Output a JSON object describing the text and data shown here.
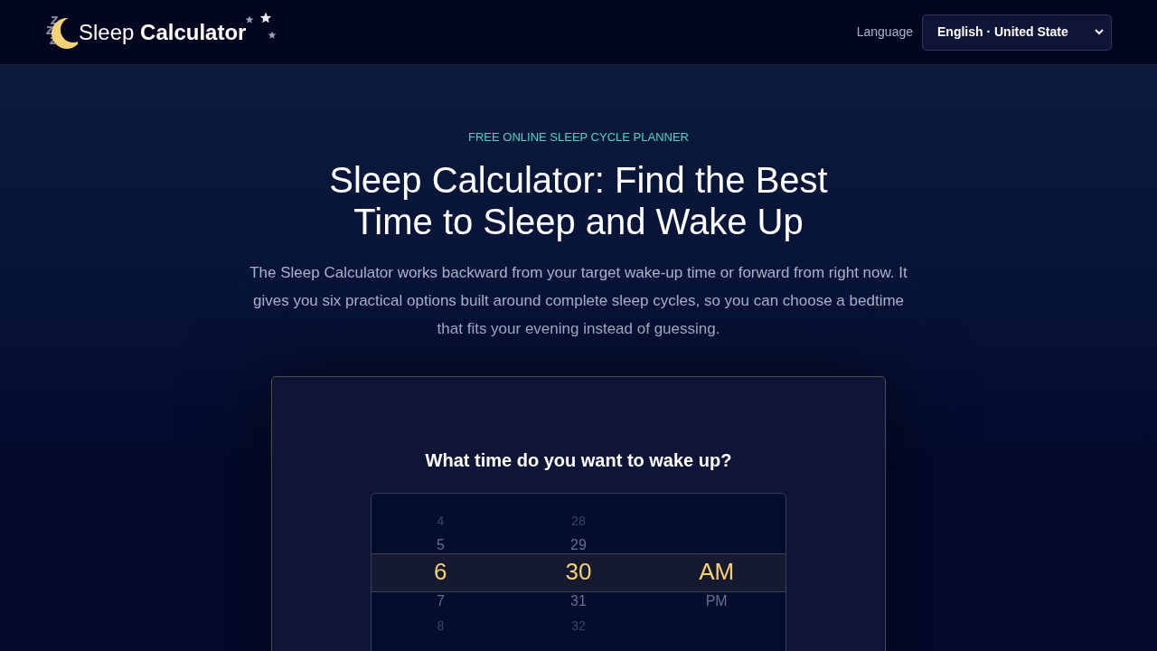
{
  "header": {
    "logo": "Sleep **Calculator**",
    "language_label": "Language",
    "language_select": {
      "value": "English · United State"
    }
  },
  "hero": {
    "eyebrow": "FREE ONLINE SLEEP CYCLE PLANNER",
    "title": "Sleep Calculator: Find the Best Time to Sleep and Wake Up",
    "intro": "The Sleep Calculator works backward from your target wake-up time or forward from right now. It gives you six practical options built around complete sleep cycles, so you can choose a bedtime that fits your evening instead of guessing."
  },
  "calculator": {
    "question": "What time do you want to wake up?",
    "time_picker": {
      "columns": [
        {
          "items": [
            {
              "label": "4",
              "selected": false
            },
            {
              "label": "5",
              "selected": false
            },
            {
              "label": "6",
              "selected": true
            },
            {
              "label": "7",
              "selected": false
            },
            {
              "label": "8",
              "selected": false
            }
          ]
        },
        {
          "items": [
            {
              "label": "28",
              "selected": false
            },
            {
              "label": "29",
              "selected": false
            },
            {
              "label": "30",
              "selected": true
            },
            {
              "label": "31",
              "selected": false
            },
            {
              "label": "32",
              "selected": false
            }
          ]
        },
        {
          "items": [
            {
              "label": "AM",
              "selected": true
            },
            {
              "label": "PM",
              "selected": false
            }
          ]
        }
      ]
    }
  }
}
